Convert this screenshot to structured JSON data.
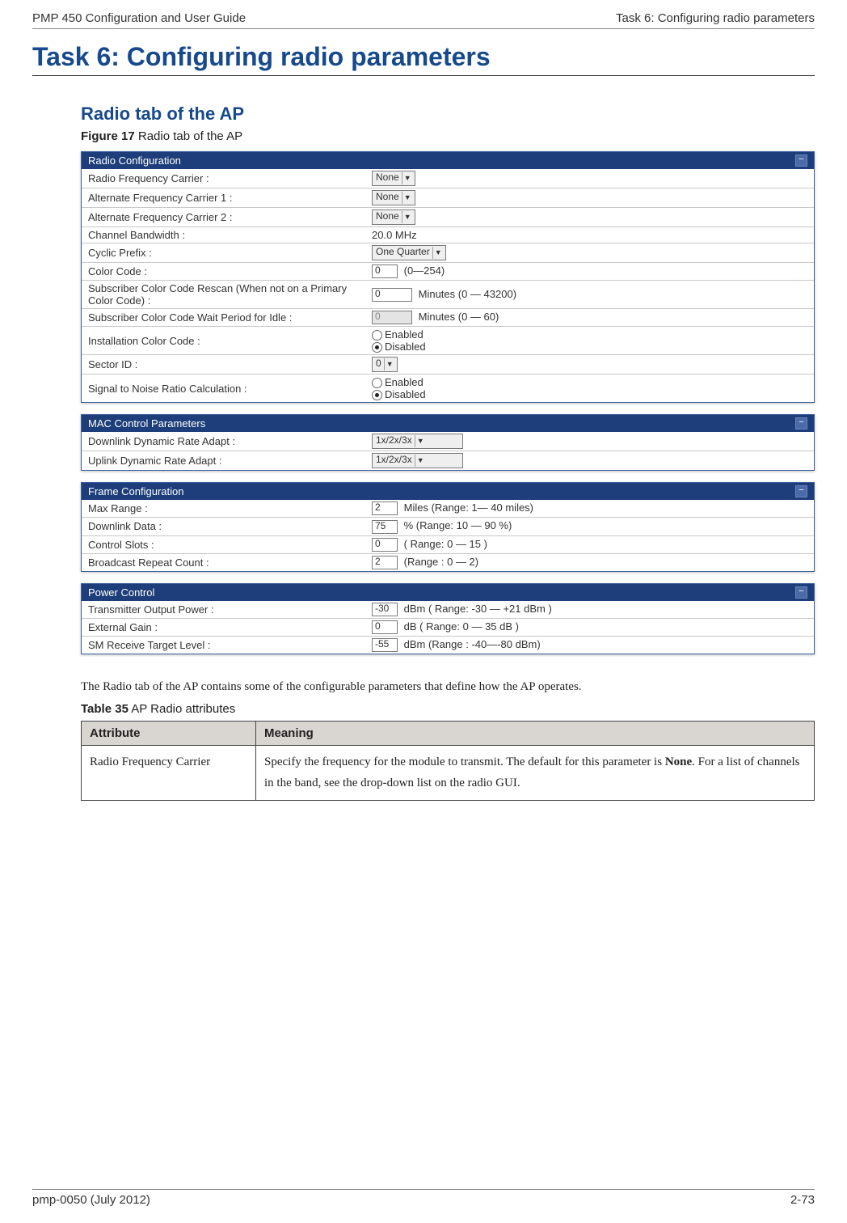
{
  "header": {
    "left": "PMP 450 Configuration and User Guide",
    "right": "Task 6: Configuring radio parameters"
  },
  "h1": "Task 6: Configuring radio parameters",
  "h2": "Radio tab of the AP",
  "figure": {
    "label_bold": "Figure 17",
    "label_rest": " Radio tab of the AP"
  },
  "panels": {
    "radio": {
      "title": "Radio Configuration",
      "rows": {
        "freq": {
          "label": "Radio Frequency Carrier :",
          "value": "None"
        },
        "alt1": {
          "label": "Alternate Frequency Carrier 1 :",
          "value": "None"
        },
        "alt2": {
          "label": "Alternate Frequency Carrier 2 :",
          "value": "None"
        },
        "bw": {
          "label": "Channel Bandwidth :",
          "value": "20.0 MHz"
        },
        "cyclic": {
          "label": "Cyclic Prefix :",
          "value": "One Quarter"
        },
        "color": {
          "label": "Color Code :",
          "value": "0",
          "hint": "(0—254)"
        },
        "rescan": {
          "label": "Subscriber Color Code Rescan (When not on a Primary Color Code) :",
          "value": "0",
          "hint": "Minutes (0 — 43200)"
        },
        "wait": {
          "label": "Subscriber Color Code Wait Period for Idle :",
          "value": "0",
          "hint": "Minutes (0 — 60)"
        },
        "inst": {
          "label": "Installation Color Code :",
          "opt1": "Enabled",
          "opt2": "Disabled"
        },
        "sector": {
          "label": "Sector ID :",
          "value": "0"
        },
        "snr": {
          "label": "Signal to Noise Ratio Calculation :",
          "opt1": "Enabled",
          "opt2": "Disabled"
        }
      }
    },
    "mac": {
      "title": "MAC Control Parameters",
      "rows": {
        "dl": {
          "label": "Downlink Dynamic Rate Adapt :",
          "value": "1x/2x/3x"
        },
        "ul": {
          "label": "Uplink Dynamic Rate Adapt :",
          "value": "1x/2x/3x"
        }
      }
    },
    "frame": {
      "title": "Frame Configuration",
      "rows": {
        "range": {
          "label": "Max Range :",
          "value": "2",
          "hint": "Miles (Range: 1— 40 miles)"
        },
        "dl": {
          "label": "Downlink Data :",
          "value": "75",
          "hint": "% (Range: 10 — 90 %)"
        },
        "slots": {
          "label": "Control Slots :",
          "value": "0",
          "hint": "( Range: 0 — 15 )"
        },
        "bcast": {
          "label": "Broadcast Repeat Count :",
          "value": "2",
          "hint": "(Range : 0 — 2)"
        }
      }
    },
    "power": {
      "title": "Power Control",
      "rows": {
        "tx": {
          "label": "Transmitter Output Power :",
          "value": "-30",
          "hint": "dBm ( Range: -30 — +21 dBm )"
        },
        "ext": {
          "label": "External Gain :",
          "value": "0",
          "hint": "dB ( Range: 0 — 35 dB )"
        },
        "sm": {
          "label": "SM Receive Target Level :",
          "value": "-55",
          "hint": "dBm (Range : -40—-80 dBm)"
        }
      }
    }
  },
  "body_para": "The Radio tab of the AP contains some of the configurable parameters that define how the AP operates.",
  "table_label": {
    "bold": "Table 35",
    "rest": "  AP Radio attributes"
  },
  "attr_table": {
    "hdr_attr": "Attribute",
    "hdr_mean": "Meaning",
    "row1_attr": "Radio Frequency Carrier",
    "row1_mean_a": "Specify the frequency for the module to transmit. The default for this parameter is ",
    "row1_mean_b": "None",
    "row1_mean_c": ".  For a list of channels in the band, see the drop-down list on the radio GUI."
  },
  "footer": {
    "left": "pmp-0050 (July 2012)",
    "right": "2-73"
  }
}
